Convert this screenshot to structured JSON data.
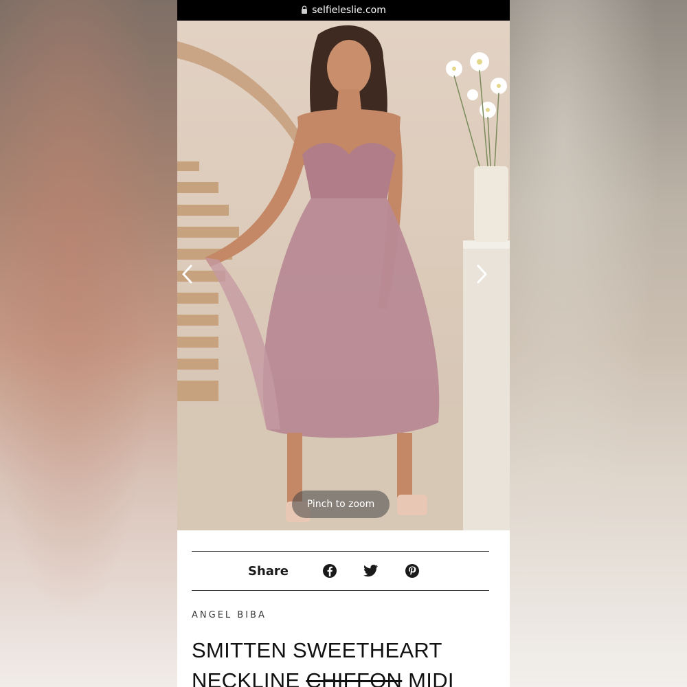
{
  "browser": {
    "url": "selfieleslie.com"
  },
  "gallery": {
    "pinch_hint": "Pinch to zoom"
  },
  "share": {
    "label": "Share",
    "icons": [
      "facebook-icon",
      "twitter-icon",
      "pinterest-icon"
    ]
  },
  "product": {
    "brand": "ANGEL BIBA",
    "title_line1": "SMITTEN SWEETHEART",
    "title_line2_start": "NECKLINE",
    "title_line2_strike": "CHIFFON",
    "title_line2_end": "MIDI"
  },
  "colors": {
    "dress": "#b88a95",
    "accent": "#1a1a1a"
  }
}
